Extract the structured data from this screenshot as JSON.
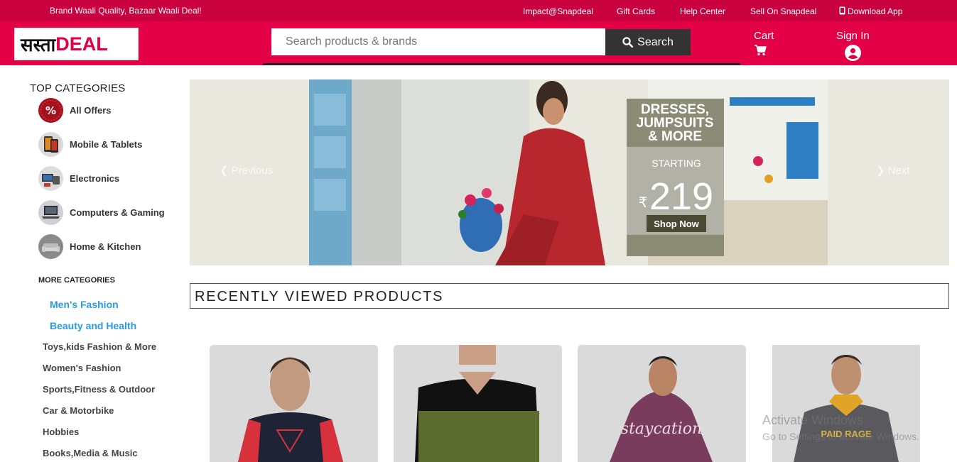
{
  "topbar": {
    "promo": "Brand Waali Quality, Bazaar Waali Deal!",
    "links": [
      "Impact@Snapdeal",
      "Gift Cards",
      "Help Center",
      "Sell On Snapdeal",
      "Download App"
    ]
  },
  "header": {
    "logo_hindi": "सस्ता",
    "logo_english": "DEAL",
    "search_placeholder": "Search products & brands",
    "search_label": "Search",
    "cart_label": "Cart",
    "signin_label": "Sign In"
  },
  "sidebar": {
    "top_title": "TOP CATEGORIES",
    "top_items": [
      {
        "label": "All Offers",
        "icon": "percent-badge-icon"
      },
      {
        "label": "Mobile & Tablets",
        "icon": "mobile-icon"
      },
      {
        "label": "Electronics",
        "icon": "electronics-icon"
      },
      {
        "label": "Computers & Gaming",
        "icon": "laptop-icon"
      },
      {
        "label": "Home & Kitchen",
        "icon": "sofa-icon"
      }
    ],
    "more_title": "MORE CATEGORIES",
    "more_items": [
      "Men's Fashion",
      "Beauty and Health",
      "Toys,kids Fashion & More",
      "Women's Fashion",
      "Sports,Fitness & Outdoor",
      "Car & Motorbike",
      "Hobbies",
      "Books,Media & Music"
    ]
  },
  "banner": {
    "prev_label": "Previous",
    "next_label": "Next",
    "headline_1": "DRESSES,",
    "headline_2": "JUMPSUITS",
    "headline_3": "& MORE",
    "starting": "STARTING",
    "price": "219",
    "currency": "₹",
    "cta": "Shop Now"
  },
  "recently_viewed": {
    "title": "RECENTLY VIEWED PRODUCTS",
    "cards": [
      {
        "print_text": ""
      },
      {
        "print_text": ""
      },
      {
        "print_text": "staycation"
      },
      {
        "print_text": "PAID RAGE"
      }
    ]
  },
  "watermark": {
    "line1": "Activate Windows",
    "line2": "Go to Settings to activate Windows."
  },
  "colors": {
    "topbar": "#c9013f",
    "header": "#e40046",
    "link_blue": "#2b9be0"
  }
}
